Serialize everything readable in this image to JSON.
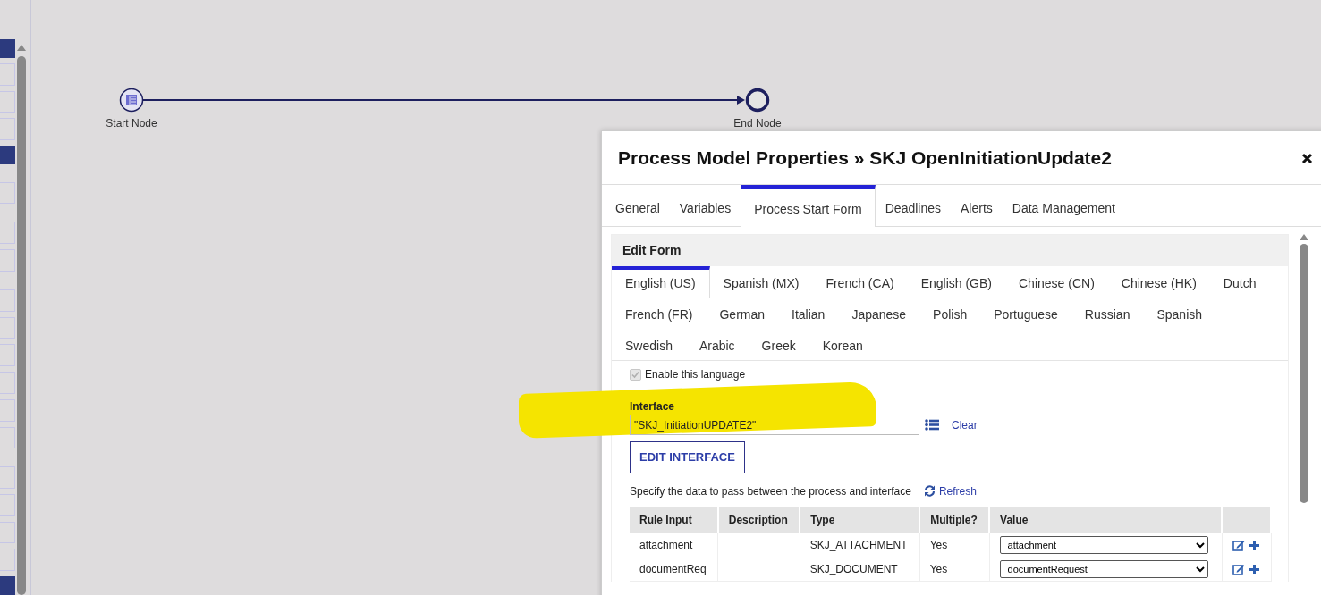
{
  "diagram": {
    "nodes": [
      {
        "kind": "start",
        "label": "Start Node"
      },
      {
        "kind": "end",
        "label": "End Node"
      }
    ]
  },
  "dialog": {
    "title": "Process Model Properties » SKJ OpenInitiationUpdate2",
    "tabs": [
      {
        "label": "General",
        "selected": false
      },
      {
        "label": "Variables",
        "selected": false
      },
      {
        "label": "Process Start Form",
        "selected": true
      },
      {
        "label": "Deadlines",
        "selected": false
      },
      {
        "label": "Alerts",
        "selected": false
      },
      {
        "label": "Data Management",
        "selected": false
      }
    ],
    "section_title": "Edit Form",
    "language_tabs": [
      {
        "label": "English (US)",
        "selected": true
      },
      {
        "label": "Spanish (MX)",
        "selected": false
      },
      {
        "label": "French (CA)",
        "selected": false
      },
      {
        "label": "English (GB)",
        "selected": false
      },
      {
        "label": "Chinese (CN)",
        "selected": false
      },
      {
        "label": "Chinese (HK)",
        "selected": false
      },
      {
        "label": "Dutch",
        "selected": false
      },
      {
        "label": "French (FR)",
        "selected": false
      },
      {
        "label": "German",
        "selected": false
      },
      {
        "label": "Italian",
        "selected": false
      },
      {
        "label": "Japanese",
        "selected": false
      },
      {
        "label": "Polish",
        "selected": false
      },
      {
        "label": "Portuguese",
        "selected": false
      },
      {
        "label": "Russian",
        "selected": false
      },
      {
        "label": "Spanish",
        "selected": false
      },
      {
        "label": "Swedish",
        "selected": false
      },
      {
        "label": "Arabic",
        "selected": false
      },
      {
        "label": "Greek",
        "selected": false
      },
      {
        "label": "Korean",
        "selected": false
      }
    ],
    "enable_language": {
      "label": "Enable this language",
      "checked": true,
      "disabled": true
    },
    "interface": {
      "label": "Interface",
      "value": "\"SKJ_InitiationUPDATE2\"",
      "clear_link": "Clear",
      "edit_button": "EDIT INTERFACE"
    },
    "data_prompt": "Specify the data to pass between the process and interface",
    "refresh_link": "Refresh",
    "table": {
      "columns": [
        "Rule Input",
        "Description",
        "Type",
        "Multiple?",
        "Value"
      ],
      "rows": [
        {
          "rule_input": "attachment",
          "type": "SKJ_ATTACHMENT",
          "multiple": "Yes",
          "value": "attachment"
        },
        {
          "rule_input": "documentReq",
          "type": "SKJ_DOCUMENT",
          "multiple": "Yes",
          "value": "documentRequest"
        }
      ]
    }
  }
}
